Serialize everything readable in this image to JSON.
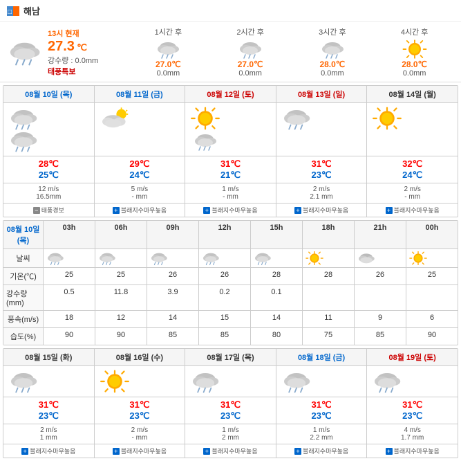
{
  "header": {
    "title": "해남",
    "icon": "location-icon"
  },
  "current": {
    "time_label": "13시 현재",
    "temp": "27.3",
    "temp_unit": "℃",
    "rain_label": "강수량 : 0.0mm",
    "alert": "태풍특보"
  },
  "hourly_forecast": [
    {
      "label": "1시간 후",
      "temp": "27.0℃",
      "rain": "0.0mm",
      "icon": "cloudy-rain"
    },
    {
      "label": "2시간 후",
      "temp": "27.0℃",
      "rain": "0.0mm",
      "icon": "cloudy-rain"
    },
    {
      "label": "3시간 후",
      "temp": "28.0℃",
      "rain": "0.0mm",
      "icon": "cloudy-rain"
    },
    {
      "label": "4시간 후",
      "temp": "28.0℃",
      "rain": "0.0mm",
      "icon": "sunny"
    }
  ],
  "fiveday": {
    "days": [
      {
        "date": "08월 10일 (목)",
        "class": "today",
        "high": "28℃",
        "low": "25℃",
        "wind": "12 m/s",
        "rain": "16.5mm",
        "alert": "태풍경보",
        "alert_type": "minus"
      },
      {
        "date": "08월 11일 (금)",
        "class": "fri",
        "high": "29℃",
        "low": "24℃",
        "wind": "5 m/s",
        "rain": "- mm",
        "alert": "블래지수마우높음",
        "alert_type": "plus"
      },
      {
        "date": "08월 12일 (토)",
        "class": "sat",
        "high": "31℃",
        "low": "21℃",
        "wind": "1 m/s",
        "rain": "- mm",
        "alert": "블래지수마우높음",
        "alert_type": "plus"
      },
      {
        "date": "08월 13일 (일)",
        "class": "sun",
        "high": "31℃",
        "low": "23℃",
        "wind": "2 m/s",
        "rain": "2.1 mm",
        "alert": "블래지수마우높음",
        "alert_type": "plus"
      },
      {
        "date": "08월 14일 (월)",
        "class": "mon",
        "high": "32℃",
        "low": "24℃",
        "wind": "2 m/s",
        "rain": "- mm",
        "alert": "블래지수마우높음",
        "alert_type": "plus"
      }
    ]
  },
  "hourly_detail": {
    "date_label": "08월 10일 (목)",
    "times": [
      "03h",
      "06h",
      "09h",
      "12h",
      "15h",
      "18h",
      "21h",
      "00h"
    ],
    "weather_label": "날씨",
    "temp_label": "기온(℃)",
    "rain_label": "강수량(mm)",
    "wind_label": "풍속(m/s)",
    "humid_label": "습도(%)",
    "temps": [
      "25",
      "25",
      "26",
      "26",
      "28",
      "28",
      "26",
      "25"
    ],
    "rains": [
      "0.5",
      "11.8",
      "3.9",
      "0.2",
      "0.1",
      "",
      "",
      ""
    ],
    "winds": [
      "18",
      "12",
      "14",
      "15",
      "14",
      "11",
      "9",
      "6"
    ],
    "humids": [
      "90",
      "90",
      "85",
      "85",
      "80",
      "75",
      "85",
      "90"
    ]
  },
  "bottom_fiveday": {
    "days": [
      {
        "date": "08월 15일 (화)",
        "class": "tue",
        "high": "31℃",
        "low": "23℃",
        "wind": "2 m/s",
        "rain": "1 mm",
        "alert": "블래지수마우높음",
        "alert_type": "plus"
      },
      {
        "date": "08월 16일 (수)",
        "class": "wed",
        "high": "31℃",
        "low": "23℃",
        "wind": "2 m/s",
        "rain": "- mm",
        "alert": "블래지수마우높음",
        "alert_type": "plus"
      },
      {
        "date": "08월 17일 (목)",
        "class": "thu",
        "high": "31℃",
        "low": "23℃",
        "wind": "1 m/s",
        "rain": "2 mm",
        "alert": "블래지수마우높음",
        "alert_type": "plus"
      },
      {
        "date": "08월 18일 (금)",
        "class": "fri2",
        "high": "31℃",
        "low": "23℃",
        "wind": "1 m/s",
        "rain": "2.2 mm",
        "alert": "블래지수마우높음",
        "alert_type": "plus"
      },
      {
        "date": "08월 19일 (토)",
        "class": "sat2",
        "high": "31℃",
        "low": "23℃",
        "wind": "4 m/s",
        "rain": "1.7 mm",
        "alert": "블래지수마우높음",
        "alert_type": "plus"
      }
    ]
  },
  "colors": {
    "accent_orange": "#ff6600",
    "accent_blue": "#0066cc",
    "accent_red": "#cc0000",
    "border": "#cccccc",
    "bg_header": "#f5f5f5"
  }
}
